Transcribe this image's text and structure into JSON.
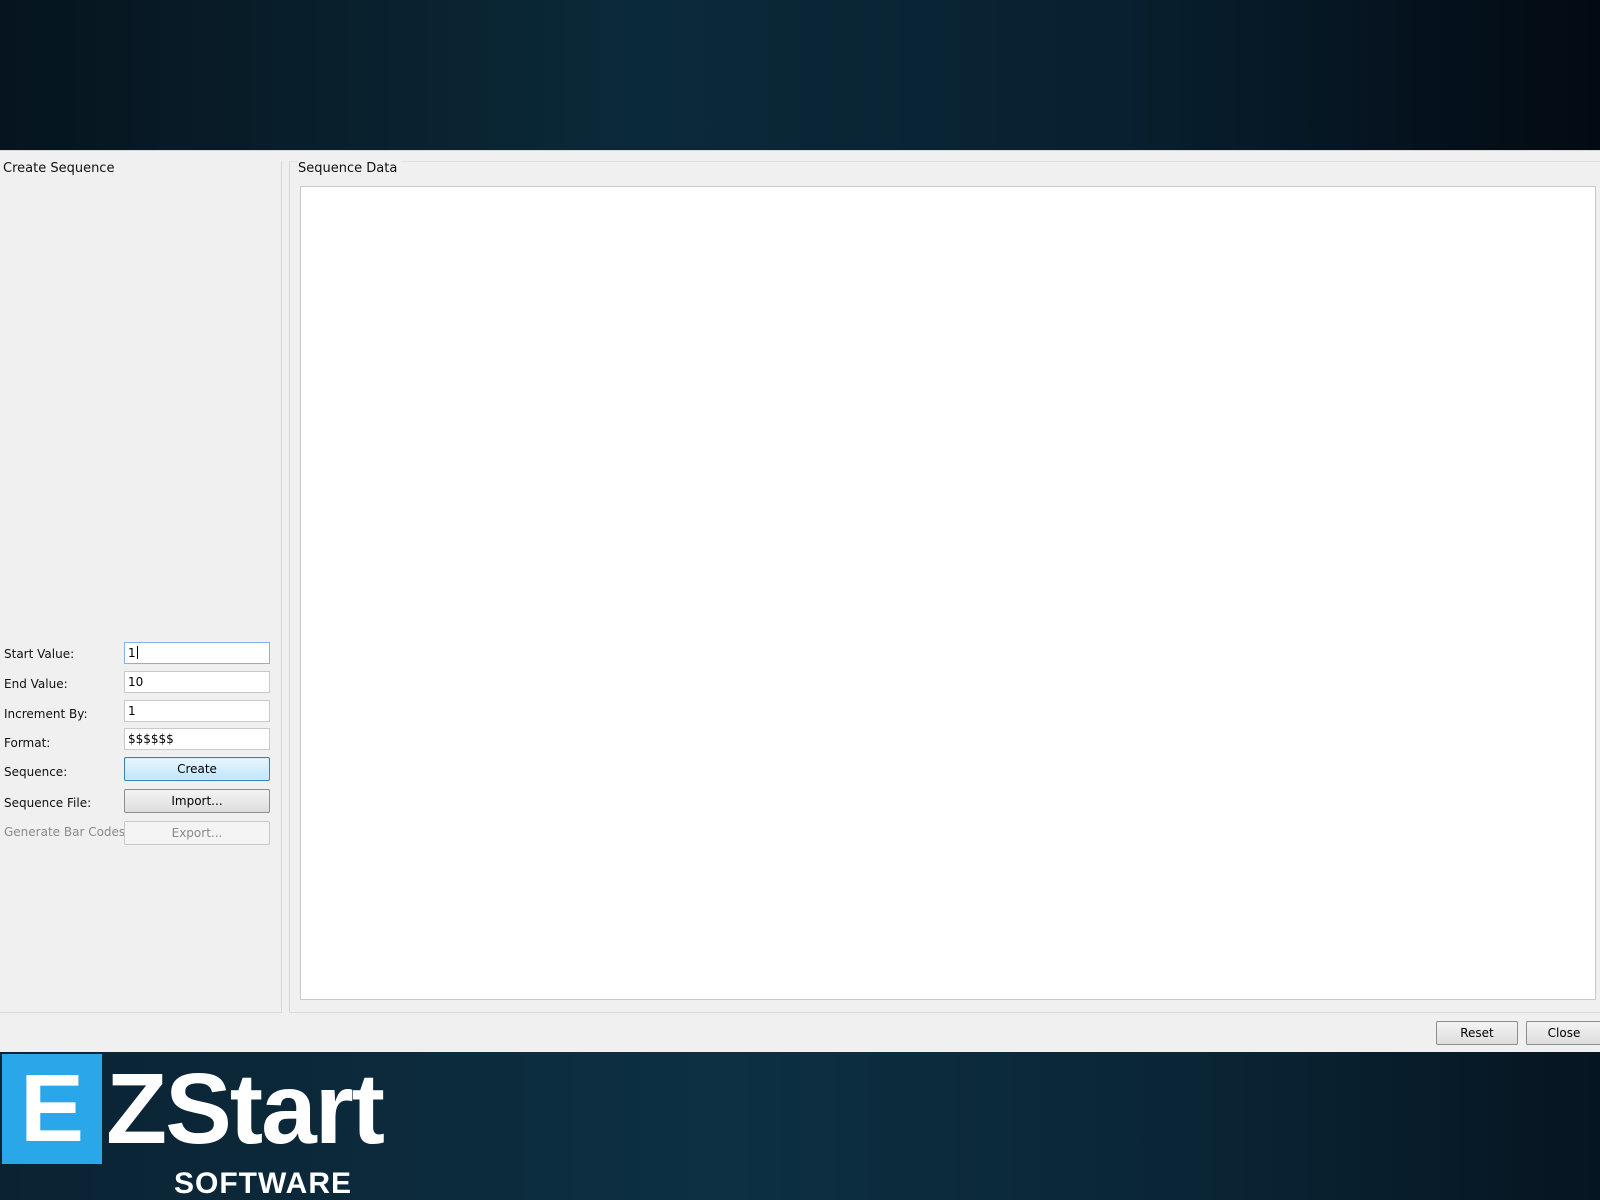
{
  "dialog": {
    "left_group": {
      "title": "Create Sequence",
      "rows": [
        {
          "label": "Start Value:",
          "value": "1"
        },
        {
          "label": "End Value:",
          "value": "10"
        },
        {
          "label": "Increment By:",
          "value": "1"
        },
        {
          "label": "Format:",
          "value": "$$$$$$"
        },
        {
          "label": "Sequence:",
          "button": "Create"
        },
        {
          "label": "Sequence File:",
          "button": "Import..."
        },
        {
          "label": "Generate Bar Codes:",
          "button": "Export..."
        }
      ]
    },
    "right_group": {
      "title": "Sequence Data",
      "content": ""
    },
    "buttons": {
      "reset": "Reset",
      "close": "Close"
    }
  },
  "branding": {
    "logo_letter": "E",
    "logo_word": "ZStart",
    "logo_sub": "SOFTWARE",
    "accent_color": "#2aa7e8"
  }
}
